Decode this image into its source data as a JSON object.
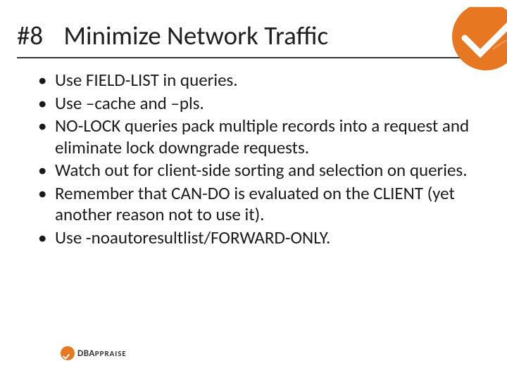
{
  "title": {
    "number": "#8",
    "text": "Minimize Network Traffic"
  },
  "bullets": [
    "Use FIELD-LIST in queries.",
    "Use –cache and –pls.",
    "NO-LOCK queries pack multiple records into a request and eliminate lock downgrade requests.",
    "Watch out for client-side sorting and selection on queries.",
    "Remember that CAN-DO is evaluated on the CLIENT (yet another reason not to use it).",
    "Use -noautoresultlist/FORWARD-ONLY."
  ],
  "footer_logo": {
    "bold": "DBA",
    "rest": "PPRAISE"
  },
  "colors": {
    "accent": "#e87722"
  }
}
